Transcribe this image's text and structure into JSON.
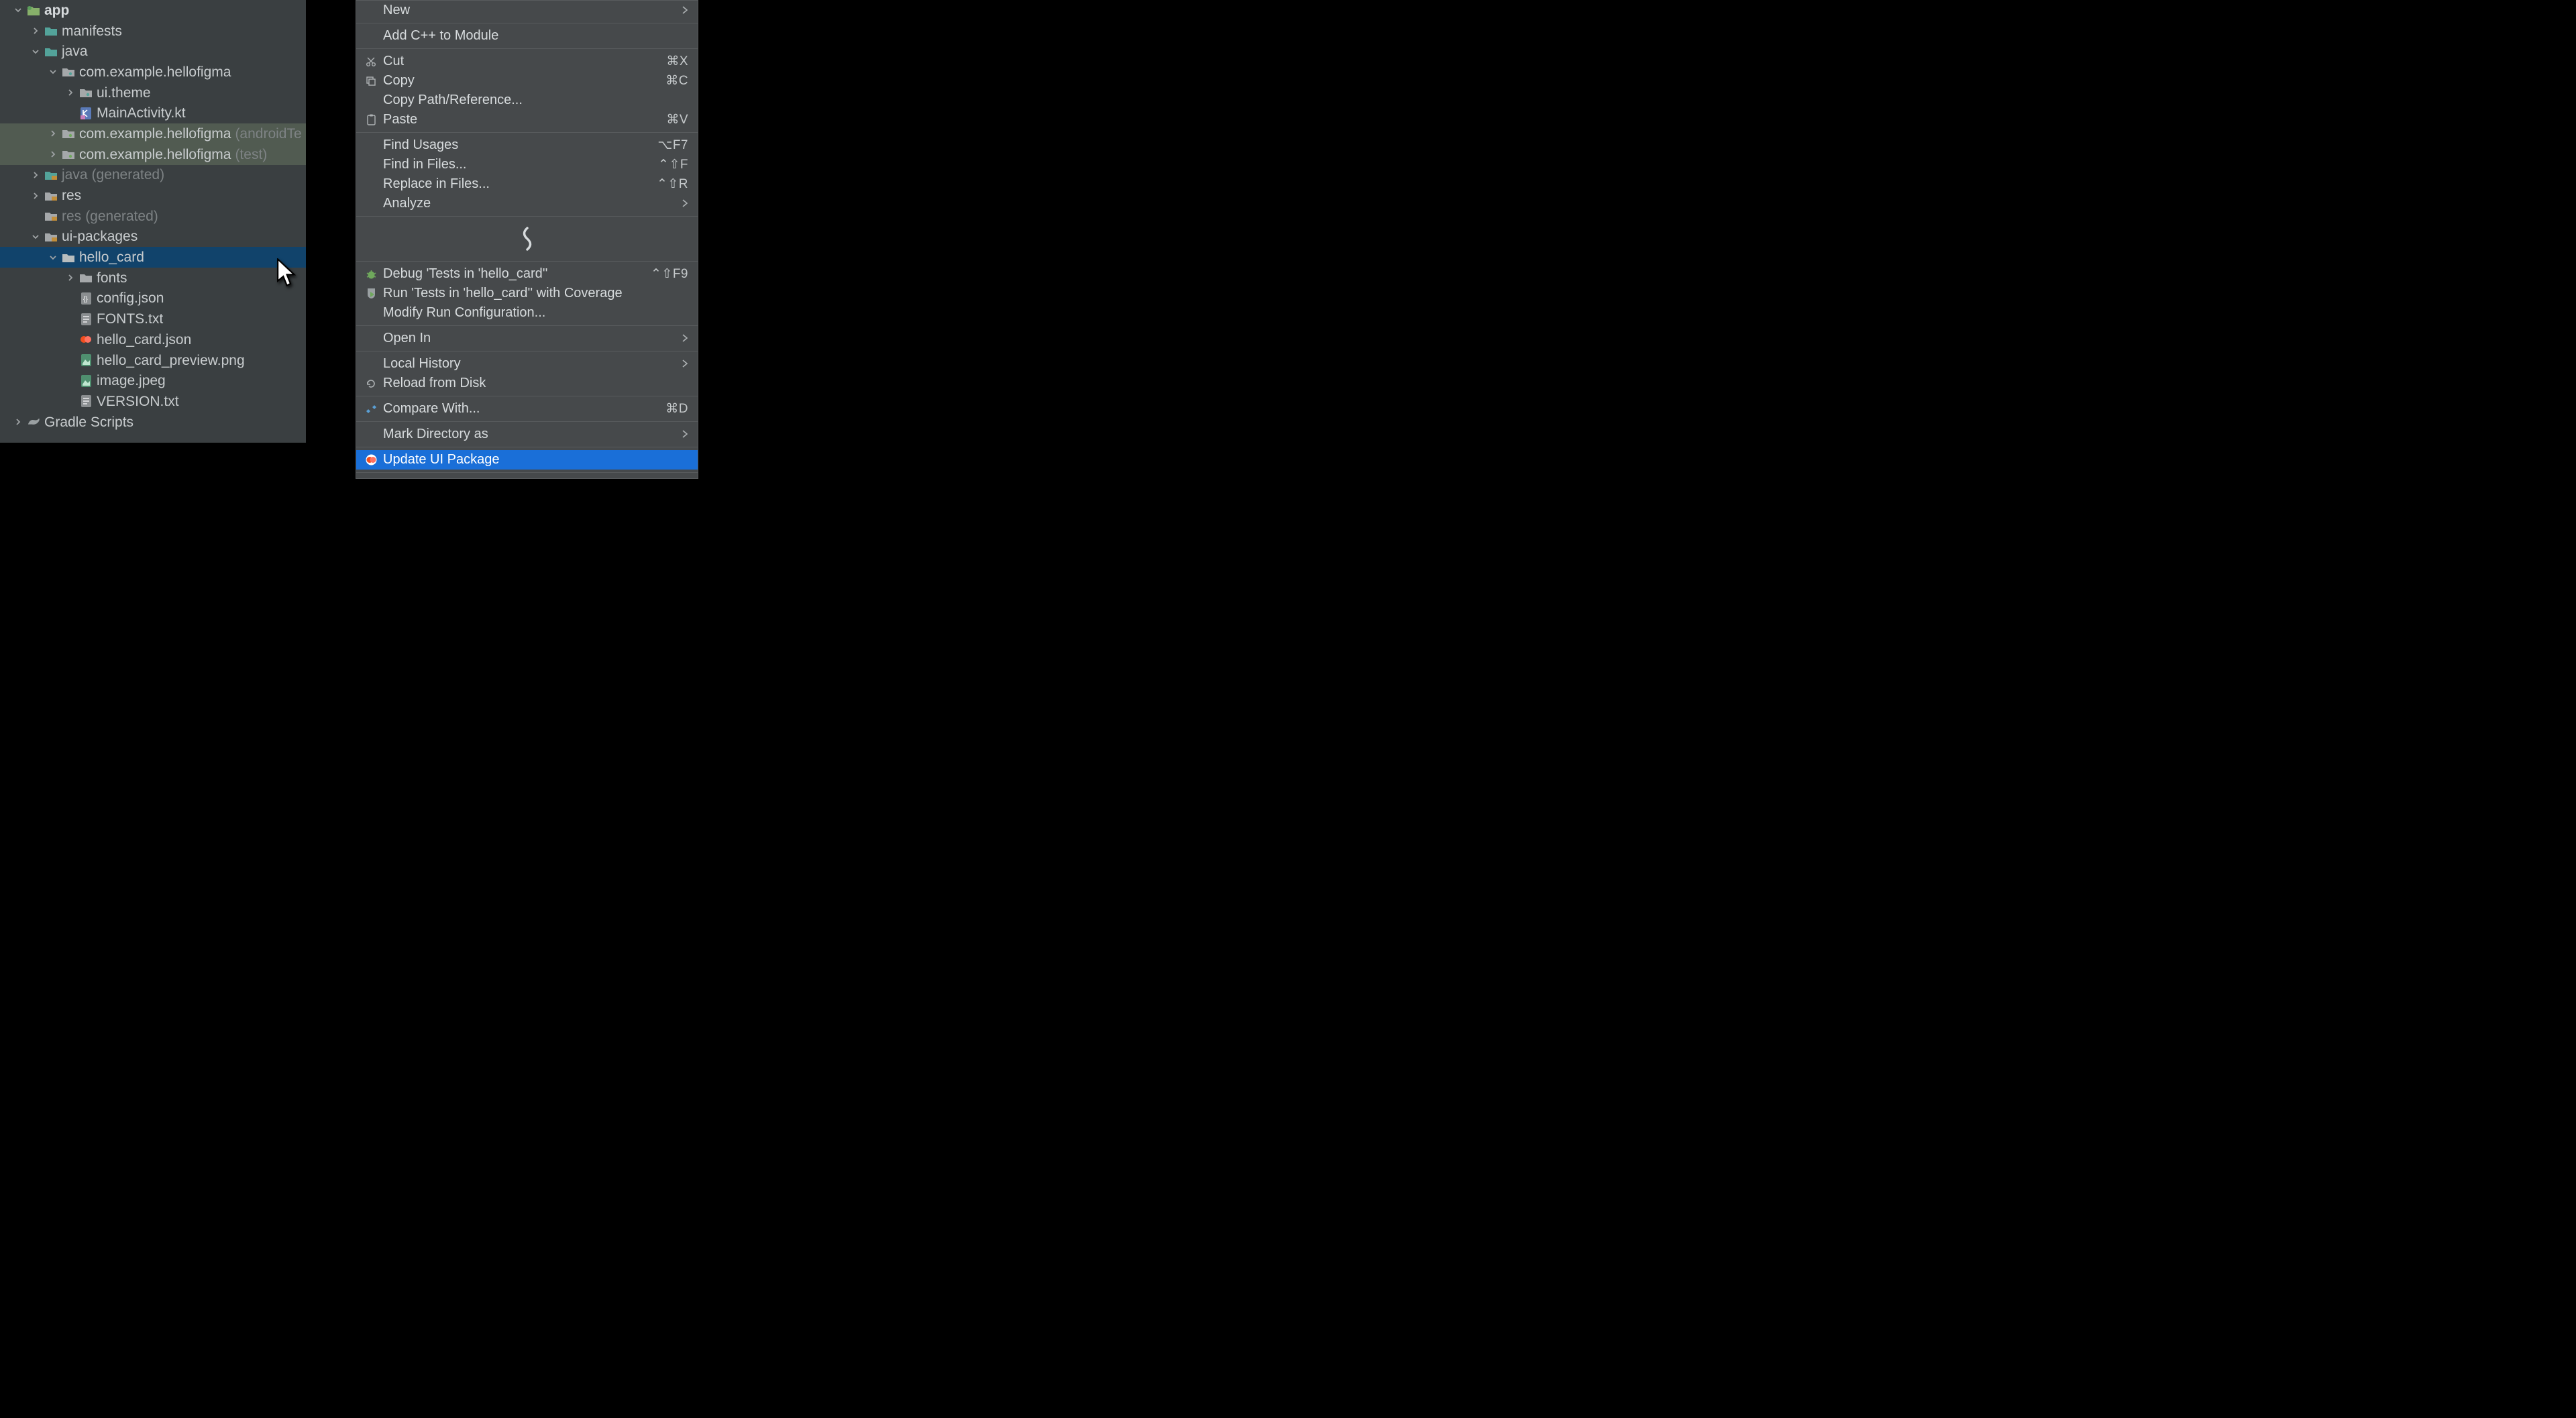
{
  "tree": {
    "app": "app",
    "manifests": "manifests",
    "java": "java",
    "pkg_main": "com.example.hellofigma",
    "ui_theme": "ui.theme",
    "main_activity": "MainActivity.kt",
    "pkg_androidTest": "com.example.hellofigma",
    "pkg_androidTest_suffix": "(androidTe",
    "pkg_test": "com.example.hellofigma",
    "pkg_test_suffix": "(test)",
    "java_gen": "java",
    "java_gen_suffix": "(generated)",
    "res": "res",
    "res_gen": "res",
    "res_gen_suffix": "(generated)",
    "ui_packages": "ui-packages",
    "hello_card": "hello_card",
    "fonts": "fonts",
    "config_json": "config.json",
    "fonts_txt": "FONTS.txt",
    "hello_card_json": "hello_card.json",
    "hello_card_preview": "hello_card_preview.png",
    "image_jpeg": "image.jpeg",
    "version_txt": "VERSION.txt",
    "gradle_scripts": "Gradle Scripts"
  },
  "menu": {
    "new": "New",
    "add_cpp": "Add C++ to Module",
    "cut": "Cut",
    "cut_sc": "⌘X",
    "copy": "Copy",
    "copy_sc": "⌘C",
    "copy_path": "Copy Path/Reference...",
    "paste": "Paste",
    "paste_sc": "⌘V",
    "find_usages": "Find Usages",
    "find_usages_sc": "⌥F7",
    "find_in_files": "Find in Files...",
    "find_in_files_sc": "⌃⇧F",
    "replace_in_files": "Replace in Files...",
    "replace_in_files_sc": "⌃⇧R",
    "analyze": "Analyze",
    "debug_tests": "Debug 'Tests in 'hello_card''",
    "debug_tests_sc": "⌃⇧F9",
    "run_coverage": "Run 'Tests in 'hello_card'' with Coverage",
    "modify_run": "Modify Run Configuration...",
    "open_in": "Open In",
    "local_history": "Local History",
    "reload_disk": "Reload from Disk",
    "compare_with": "Compare With...",
    "compare_with_sc": "⌘D",
    "mark_dir": "Mark Directory as",
    "update_ui": "Update UI Package"
  }
}
